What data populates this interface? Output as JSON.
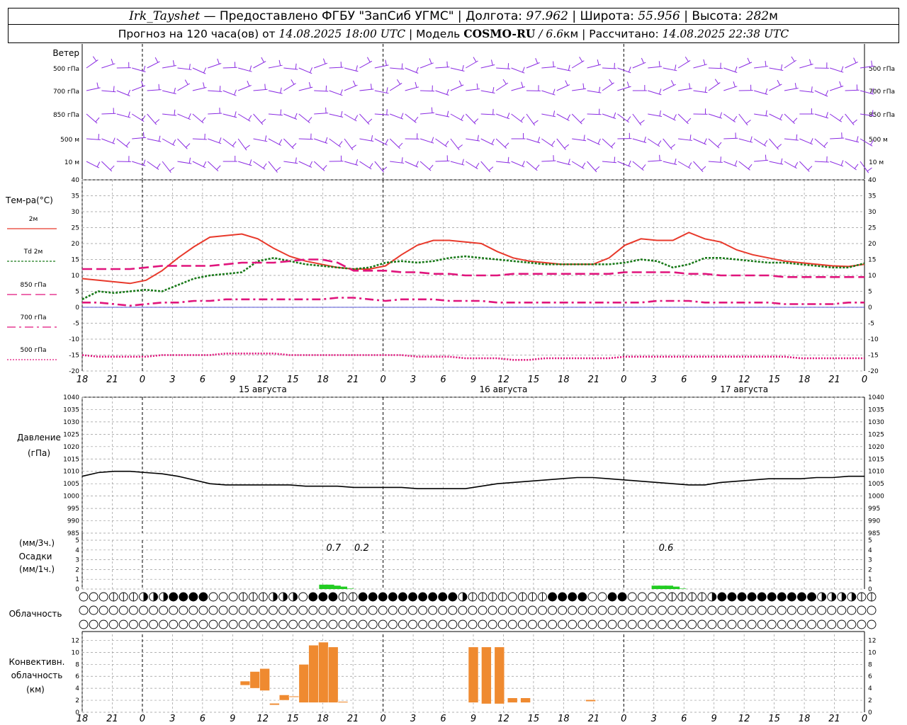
{
  "header": {
    "station": "Irk_Tayshet",
    "provided_by": "— Предоставлено ФГБУ \"ЗапСиб УГМС\" |",
    "lon_label": "Долгота:",
    "lon_value": "97.962",
    "lat_label": "| Широта:",
    "lat_value": "55.956",
    "alt_label": "| Высота:",
    "alt_value": "282",
    "alt_unit": "м",
    "forecast_prefix": "Прогноз на 120 часа(ов) от",
    "forecast_start": "14.08.2025 18:00 UTC",
    "model_label": "| Модель",
    "model_name": "COSMO-RU",
    "model_res": "/ 6.6",
    "model_res_unit": "км",
    "computed_label": "| Рассчитано:",
    "computed_time": "14.08.2025 22:38 UTC"
  },
  "wind_panel": {
    "title": "Ветер",
    "levels": [
      "500 гПа",
      "700 гПа",
      "850 гПа",
      "500 м",
      "10  м"
    ],
    "color": "#8a2be2"
  },
  "time_axis": {
    "hour_labels": [
      "18",
      "21",
      "0",
      "3",
      "6",
      "9",
      "12",
      "15",
      "18",
      "21",
      "0",
      "3",
      "6",
      "9",
      "12",
      "15",
      "18",
      "21",
      "0",
      "3",
      "6",
      "9",
      "12",
      "15",
      "18",
      "21",
      "0"
    ],
    "day_labels": [
      "15 августа",
      "16 августа",
      "17 августа"
    ]
  },
  "chart_data": [
    {
      "type": "line",
      "title": "Тем-ра(°C)",
      "ylim": [
        -20,
        40
      ],
      "yticks": [
        "40",
        "35",
        "30",
        "25",
        "20",
        "15",
        "10",
        "5",
        "0",
        "-5",
        "-10",
        "-15",
        "-20"
      ],
      "x_hours": [
        0,
        3,
        6,
        9,
        12,
        15,
        18,
        21,
        24,
        27,
        30,
        33,
        36,
        39,
        42,
        45,
        48,
        51,
        54,
        57,
        60,
        63,
        66,
        69,
        72,
        75,
        78,
        81,
        84,
        87,
        90,
        93,
        96,
        99,
        102,
        105,
        108,
        111,
        114,
        117,
        120,
        123,
        126,
        129,
        132,
        135,
        138,
        141,
        144,
        147,
        150,
        153,
        156,
        159,
        162,
        165,
        168,
        171,
        174,
        177,
        180,
        183,
        186,
        189,
        192,
        195,
        198,
        201,
        204,
        207,
        210,
        213,
        216,
        219,
        222,
        225,
        228,
        231,
        234,
        237
      ],
      "series": [
        {
          "name": "2м",
          "color": "#e8392b",
          "dash": "solid",
          "values": [
            9.0,
            8.5,
            8.0,
            7.5,
            8.5,
            11.5,
            15.5,
            19.0,
            22.0,
            22.5,
            23.0,
            21.5,
            18.5,
            16.0,
            14.5,
            13.5,
            12.5,
            12.0,
            12.0,
            13.0,
            16.5,
            19.5,
            21.0,
            21.0,
            20.5,
            20.0,
            17.5,
            15.5,
            14.5,
            14.0,
            13.5,
            13.5,
            13.5,
            15.5,
            19.5,
            21.5,
            21.0,
            21.0,
            23.5,
            21.5,
            20.5,
            18.0,
            16.5,
            15.5,
            14.5,
            14.0,
            13.5,
            13.0,
            12.8,
            13.5
          ]
        },
        {
          "name": "Td  2м",
          "color": "#1a7a1a",
          "dash": "dotted",
          "values": [
            2.5,
            5.0,
            4.5,
            5.0,
            5.5,
            5.0,
            7.0,
            9.0,
            10.0,
            10.5,
            11.0,
            14.5,
            15.5,
            14.5,
            13.5,
            13.0,
            12.5,
            12.0,
            12.5,
            14.0,
            14.5,
            14.0,
            14.5,
            15.5,
            16.0,
            15.5,
            15.0,
            14.5,
            14.0,
            13.5,
            13.5,
            13.5,
            13.5,
            13.5,
            14.0,
            15.0,
            14.5,
            12.5,
            13.5,
            15.5,
            15.5,
            15.0,
            14.5,
            14.0,
            14.0,
            13.5,
            13.0,
            12.5,
            12.5,
            13.8
          ]
        },
        {
          "name": "850 гПа",
          "color": "#e0147c",
          "dash": "longdash",
          "values": [
            12.0,
            12.0,
            12.0,
            12.0,
            12.5,
            13.0,
            13.0,
            13.0,
            13.0,
            13.5,
            14.0,
            14.0,
            14.0,
            14.5,
            15.0,
            15.0,
            14.0,
            11.5,
            11.5,
            11.5,
            11.0,
            11.0,
            10.5,
            10.5,
            10.0,
            10.0,
            10.0,
            10.5,
            10.5,
            10.5,
            10.5,
            10.5,
            10.5,
            10.5,
            11.0,
            11.0,
            11.0,
            11.0,
            10.5,
            10.5,
            10.0,
            10.0,
            10.0,
            10.0,
            9.5,
            9.5,
            9.5,
            9.5,
            9.5,
            9.5
          ]
        },
        {
          "name": "700 гПа",
          "color": "#e0147c",
          "dash": "dashdot",
          "values": [
            1.5,
            1.5,
            1.0,
            0.5,
            1.0,
            1.5,
            1.5,
            2.0,
            2.0,
            2.5,
            2.5,
            2.5,
            2.5,
            2.5,
            2.5,
            2.5,
            3.0,
            3.0,
            2.5,
            2.0,
            2.5,
            2.5,
            2.5,
            2.0,
            2.0,
            2.0,
            1.5,
            1.5,
            1.5,
            1.5,
            1.5,
            1.5,
            1.5,
            1.5,
            1.5,
            1.5,
            2.0,
            2.0,
            2.0,
            1.5,
            1.5,
            1.5,
            1.5,
            1.5,
            1.0,
            1.0,
            1.0,
            1.0,
            1.5,
            1.5
          ]
        },
        {
          "name": "500 гПа",
          "color": "#e0147c",
          "dash": "dotted-fine",
          "values": [
            -15.0,
            -15.5,
            -15.5,
            -15.5,
            -15.5,
            -15.0,
            -15.0,
            -15.0,
            -15.0,
            -14.5,
            -14.5,
            -14.5,
            -14.5,
            -15.0,
            -15.0,
            -15.0,
            -15.0,
            -15.0,
            -15.0,
            -15.0,
            -15.0,
            -15.5,
            -15.5,
            -15.5,
            -16.0,
            -16.0,
            -16.0,
            -16.5,
            -16.5,
            -16.0,
            -16.0,
            -16.0,
            -16.0,
            -16.0,
            -15.5,
            -15.5,
            -15.5,
            -15.5,
            -15.5,
            -15.5,
            -15.5,
            -15.5,
            -15.5,
            -15.5,
            -15.5,
            -16.0,
            -16.0,
            -16.0,
            -16.0,
            -16.0
          ]
        }
      ]
    },
    {
      "type": "line",
      "title": "Давление",
      "unit_label": "(гПа)",
      "ylim": [
        985,
        1040
      ],
      "yticks": [
        "1040",
        "1035",
        "1030",
        "1025",
        "1020",
        "1015",
        "1010",
        "1005",
        "1000",
        "995",
        "990",
        "985"
      ],
      "series": [
        {
          "name": "",
          "color": "#000000",
          "dash": "solid",
          "values": [
            1008.0,
            1009.5,
            1010.0,
            1010.0,
            1009.5,
            1009.0,
            1008.0,
            1006.5,
            1005.0,
            1004.5,
            1004.5,
            1004.5,
            1004.5,
            1004.5,
            1004.0,
            1004.0,
            1004.0,
            1003.5,
            1003.5,
            1003.5,
            1003.5,
            1003.0,
            1003.0,
            1003.0,
            1003.0,
            1004.0,
            1005.0,
            1005.5,
            1006.0,
            1006.5,
            1007.0,
            1007.5,
            1007.5,
            1007.0,
            1006.5,
            1006.0,
            1005.5,
            1005.0,
            1004.5,
            1004.5,
            1005.5,
            1006.0,
            1006.5,
            1007.0,
            1007.0,
            1007.0,
            1007.5,
            1007.5,
            1008.0,
            1008.0
          ]
        }
      ]
    },
    {
      "type": "bar",
      "title": "Осадки",
      "unit_labels": [
        "(мм/3ч.)",
        "(мм/1ч.)"
      ],
      "ylim": [
        0,
        5
      ],
      "yticks": [
        "5",
        "4",
        "3",
        "2",
        "1",
        "0"
      ],
      "totals": [
        {
          "hour": 39,
          "label": "0.7"
        },
        {
          "hour": 42,
          "label": "0.2"
        },
        {
          "hour": 90,
          "label": "0.6"
        }
      ],
      "bars": [
        {
          "hour": 37,
          "value": 0.45
        },
        {
          "hour": 38,
          "value": 0.45
        },
        {
          "hour": 39,
          "value": 0.35
        },
        {
          "hour": 40,
          "value": 0.25
        },
        {
          "hour": 41,
          "value": 0.05
        },
        {
          "hour": 88,
          "value": 0.35
        },
        {
          "hour": 89,
          "value": 0.35
        },
        {
          "hour": 90,
          "value": 0.35
        },
        {
          "hour": 91,
          "value": 0.25
        },
        {
          "hour": 92,
          "value": 0.05
        }
      ],
      "color": "#22cc22"
    },
    {
      "type": "bar",
      "title": "Конвективн. облачность",
      "unit_label": "(км)",
      "ylim": [
        0,
        13
      ],
      "yticks": [
        "12",
        "10",
        "8",
        "6",
        "4",
        "2",
        "0"
      ],
      "bars": [
        {
          "hour": 25.0,
          "base": 4.5,
          "top": 5.2
        },
        {
          "hour": 26.5,
          "base": 4.0,
          "top": 6.8
        },
        {
          "hour": 28.0,
          "base": 3.6,
          "top": 7.3
        },
        {
          "hour": 29.5,
          "base": 1.2,
          "top": 1.5
        },
        {
          "hour": 31.0,
          "base": 2.0,
          "top": 2.9
        },
        {
          "hour": 32.5,
          "base": 2.5,
          "top": 2.7
        },
        {
          "hour": 34.0,
          "base": 1.6,
          "top": 8.0
        },
        {
          "hour": 35.5,
          "base": 1.6,
          "top": 11.2
        },
        {
          "hour": 37.0,
          "base": 1.6,
          "top": 11.7
        },
        {
          "hour": 38.5,
          "base": 1.6,
          "top": 10.9
        },
        {
          "hour": 40.0,
          "base": 1.6,
          "top": 1.8
        },
        {
          "hour": 60.0,
          "base": 1.6,
          "top": 10.9
        },
        {
          "hour": 62.0,
          "base": 1.4,
          "top": 10.9
        },
        {
          "hour": 64.0,
          "base": 1.4,
          "top": 10.9
        },
        {
          "hour": 66.0,
          "base": 1.6,
          "top": 2.4
        },
        {
          "hour": 68.0,
          "base": 1.6,
          "top": 2.4
        },
        {
          "hour": 78.0,
          "base": 1.8,
          "top": 2.1
        }
      ],
      "color": "#ef8a30"
    }
  ],
  "cloud_panel": {
    "title": "Облачность",
    "rows": [
      "0001234448888000123456088823888888888863321012388880088000011134888888888866443321003444888888888664000000",
      "0000000000000000000000000000000000000000000000000000000000000000000000000000000000000000000000000000000",
      "0000000000000000000000000000000000000000000000000000000000000000000000000000000000000000000000000000000"
    ]
  }
}
